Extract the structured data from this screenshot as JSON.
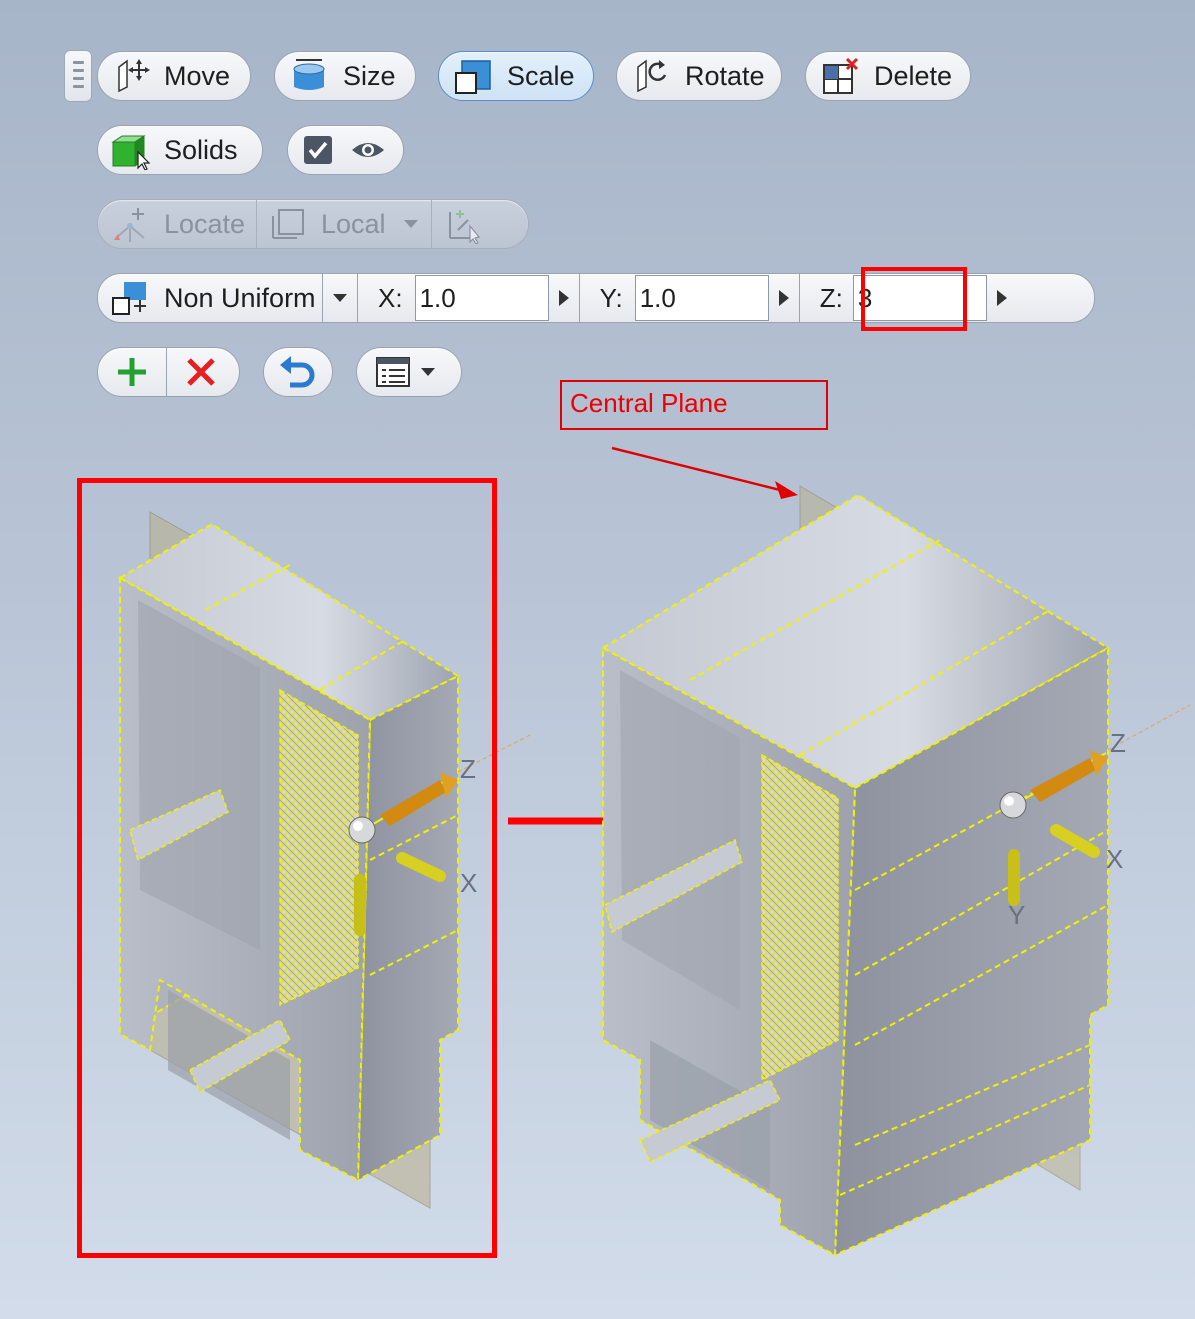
{
  "toolbar": {
    "row1": {
      "move_label": "Move",
      "size_label": "Size",
      "scale_label": "Scale",
      "rotate_label": "Rotate",
      "delete_label": "Delete"
    },
    "row2": {
      "solids_label": "Solids"
    },
    "row3": {
      "locate_label": "Locate",
      "local_label": "Local"
    },
    "row4": {
      "mode_label": "Non Uniform",
      "x_label": "X:",
      "x_value": "1.0",
      "y_label": "Y:",
      "y_value": "1.0",
      "z_label": "Z:",
      "z_value": "3"
    }
  },
  "annotation": {
    "label": "Central Plane"
  },
  "viewport": {
    "axis_z": "Z",
    "axis_x": "X",
    "axis_y": "Y"
  },
  "colors": {
    "highlight": "#ff0000",
    "selection": "#f2f200",
    "active_button": "#cfe3f5",
    "accent": "#3b8fd6"
  }
}
